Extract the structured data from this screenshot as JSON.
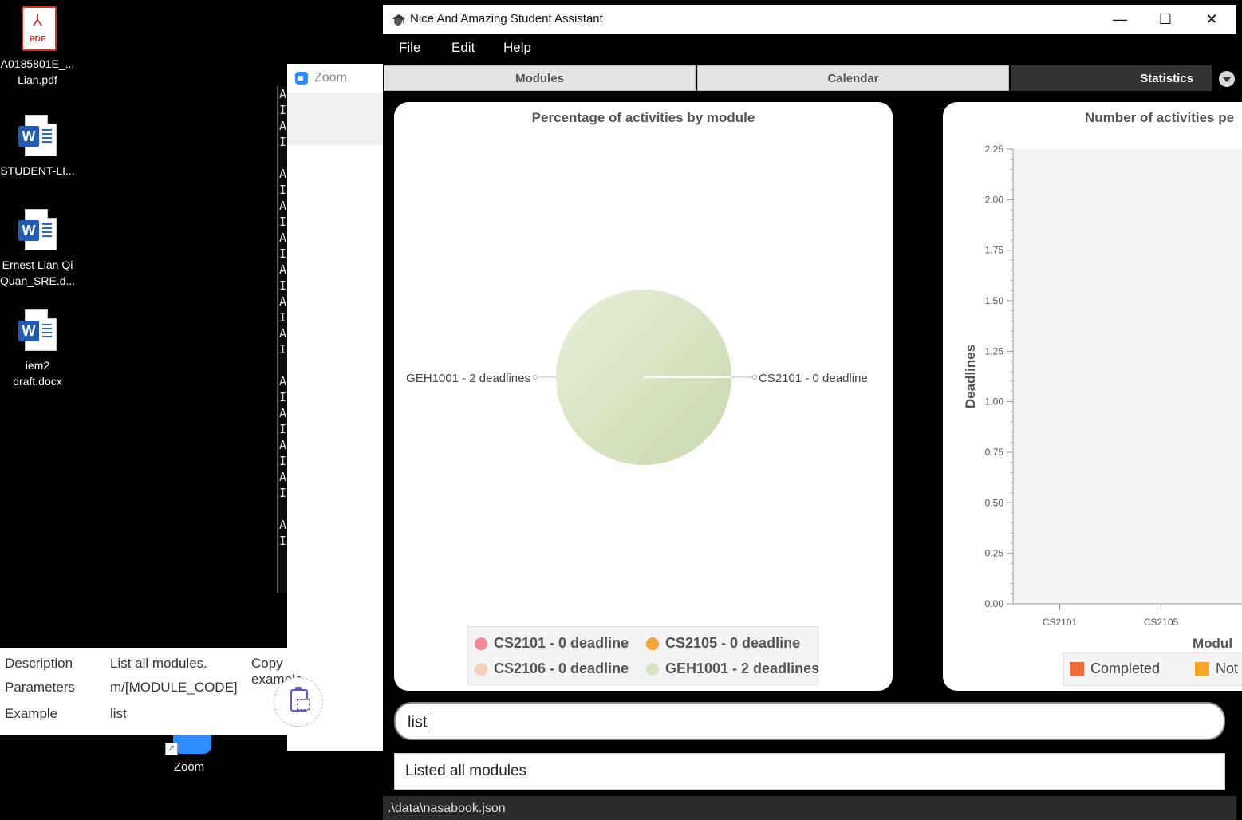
{
  "desktop": {
    "icons": [
      {
        "label": "A0185801E_...\nLian.pdf",
        "line1": "A0185801E_...",
        "line2": "Lian.pdf",
        "pdf_text": "PDF"
      },
      {
        "line1": "STUDENT-LI...",
        "line2": "",
        "word_text": "W"
      },
      {
        "line1": "Ernest Lian Qi",
        "line2": "Quan_SRE.d...",
        "word_text": "W"
      },
      {
        "line1": "iem2",
        "line2": "draft.docx",
        "word_text": "W"
      }
    ],
    "zoom_shortcut": "Zoom"
  },
  "terminal_chars": [
    "A",
    "I",
    "A",
    "I",
    "",
    "A",
    "I",
    "A",
    "I",
    "A",
    "I",
    "A",
    "I",
    "A",
    "I",
    "A",
    "I",
    "",
    "A",
    "I",
    "A",
    "I",
    "A",
    "I",
    "A",
    "I",
    "",
    "A",
    "I"
  ],
  "zoom_window": {
    "title": "Zoom"
  },
  "help_popup": {
    "description_label": "Description",
    "description_value": "List all modules.",
    "parameters_label": "Parameters",
    "parameters_value": "m/[MODULE_CODE]",
    "example_label": "Example",
    "example_value": "list",
    "copy_label": "Copy example"
  },
  "app": {
    "title": "Nice And Amazing Student Assistant",
    "window_controls": {
      "minimize": "—",
      "maximize": "☐",
      "close": "✕"
    },
    "menu": [
      "File",
      "Edit",
      "Help"
    ],
    "tabs": [
      "Modules",
      "Calendar",
      "Statistics"
    ],
    "active_tab": "Statistics",
    "command_input": "list",
    "result": "Listed all modules",
    "status_path": ".\\data\\nasabook.json"
  },
  "chart_data": [
    {
      "type": "pie",
      "title": "Percentage of activities by module",
      "labels": [
        "CS2101 - 0 deadline",
        "CS2105 - 0 deadline",
        "CS2106 - 0 deadline",
        "GEH1001 - 2 deadlines"
      ],
      "values": [
        0,
        0,
        0,
        2
      ],
      "colors": [
        "#f08b96",
        "#f2a33a",
        "#f3d0b8",
        "#d7e4bf"
      ],
      "slice_labels": [
        "GEH1001 - 2 deadlines",
        "CS2101 - 0 deadline"
      ],
      "legend": "bottom"
    },
    {
      "type": "bar",
      "title": "Number of activities pe",
      "xlabel": "Modul",
      "ylabel": "Deadlines",
      "categories": [
        "CS2101",
        "CS2105"
      ],
      "ylim": [
        0,
        2.25
      ],
      "yticks": [
        "0.00",
        "0.25",
        "0.50",
        "0.75",
        "1.00",
        "1.25",
        "1.50",
        "1.75",
        "2.00",
        "2.25"
      ],
      "series": [
        {
          "name": "Completed",
          "color": "#f26b3a",
          "values": [
            0,
            0
          ]
        },
        {
          "name": "Not",
          "color": "#f5a623",
          "values": [
            0,
            0
          ]
        }
      ],
      "legend": "bottom"
    }
  ]
}
